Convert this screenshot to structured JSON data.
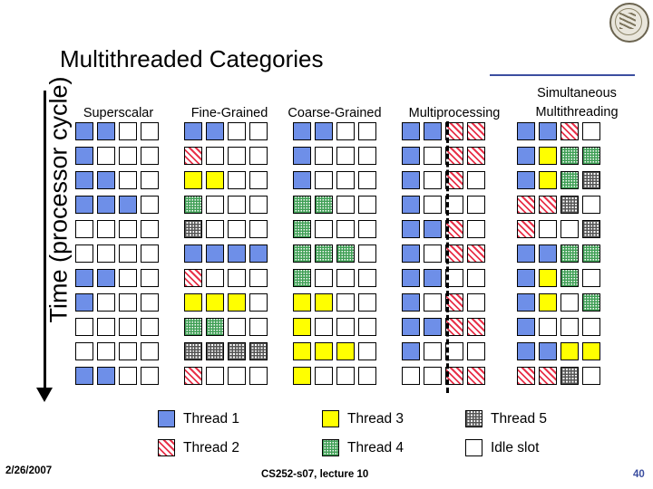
{
  "title": "Multithreaded Categories",
  "y_axis_label": "Time (processor cycle)",
  "columns": [
    {
      "name": "superscalar",
      "label": "Superscalar",
      "label2": ""
    },
    {
      "name": "fine-grained",
      "label": "Fine-Grained",
      "label2": ""
    },
    {
      "name": "coarse-grained",
      "label": "Coarse-Grained",
      "label2": ""
    },
    {
      "name": "multiprocessing",
      "label": "Multiprocessing",
      "label2": ""
    },
    {
      "name": "simultaneous-multithreading",
      "label": "Simultaneous",
      "label2": "Multithreading"
    }
  ],
  "legend": [
    {
      "key": "t1",
      "label": "Thread 1"
    },
    {
      "key": "t3",
      "label": "Thread 3"
    },
    {
      "key": "t5",
      "label": "Thread 5"
    },
    {
      "key": "t2",
      "label": "Thread 2"
    },
    {
      "key": "t4",
      "label": "Thread 4"
    },
    {
      "key": "idle",
      "label": "Idle slot"
    }
  ],
  "footer": {
    "date": "2/26/2007",
    "center": "CS252-s07, lecture 10",
    "page": "40"
  },
  "colors": {
    "thread1": "#6e8fe8",
    "thread2": "#e8324a",
    "thread3": "#ffff00",
    "thread4": "#3f9f55",
    "thread5": "#555555",
    "idle": "#ffffff",
    "accent": "#3b4ea0"
  },
  "grids": {
    "superscalar": [
      [
        "t1",
        "t1",
        "idle",
        "idle"
      ],
      [
        "t1",
        "idle",
        "idle",
        "idle"
      ],
      [
        "t1",
        "t1",
        "idle",
        "idle"
      ],
      [
        "t1",
        "t1",
        "t1",
        "idle"
      ],
      [
        "idle",
        "idle",
        "idle",
        "idle"
      ],
      [
        "idle",
        "idle",
        "idle",
        "idle"
      ],
      [
        "t1",
        "t1",
        "idle",
        "idle"
      ],
      [
        "t1",
        "idle",
        "idle",
        "idle"
      ],
      [
        "idle",
        "idle",
        "idle",
        "idle"
      ],
      [
        "idle",
        "idle",
        "idle",
        "idle"
      ],
      [
        "t1",
        "t1",
        "idle",
        "idle"
      ]
    ],
    "fine-grained": [
      [
        "t1",
        "t1",
        "idle",
        "idle"
      ],
      [
        "t2",
        "idle",
        "idle",
        "idle"
      ],
      [
        "t3",
        "t3",
        "idle",
        "idle"
      ],
      [
        "t4",
        "idle",
        "idle",
        "idle"
      ],
      [
        "t5",
        "idle",
        "idle",
        "idle"
      ],
      [
        "t1",
        "t1",
        "t1",
        "t1"
      ],
      [
        "t2",
        "idle",
        "idle",
        "idle"
      ],
      [
        "t3",
        "t3",
        "t3",
        "idle"
      ],
      [
        "t4",
        "t4",
        "idle",
        "idle"
      ],
      [
        "t5",
        "t5",
        "t5",
        "t5"
      ],
      [
        "t2",
        "idle",
        "idle",
        "idle"
      ]
    ],
    "coarse-grained": [
      [
        "t1",
        "t1",
        "idle",
        "idle"
      ],
      [
        "t1",
        "idle",
        "idle",
        "idle"
      ],
      [
        "t1",
        "idle",
        "idle",
        "idle"
      ],
      [
        "t4",
        "t4",
        "idle",
        "idle"
      ],
      [
        "t4",
        "idle",
        "idle",
        "idle"
      ],
      [
        "t4",
        "t4",
        "t4",
        "idle"
      ],
      [
        "t4",
        "idle",
        "idle",
        "idle"
      ],
      [
        "t3",
        "t3",
        "idle",
        "idle"
      ],
      [
        "t3",
        "idle",
        "idle",
        "idle"
      ],
      [
        "t3",
        "t3",
        "t3",
        "idle"
      ],
      [
        "t3",
        "idle",
        "idle",
        "idle"
      ]
    ],
    "multiprocessing": [
      [
        "t1",
        "t1",
        "t2",
        "t2"
      ],
      [
        "t1",
        "idle",
        "t2",
        "t2"
      ],
      [
        "t1",
        "idle",
        "t2",
        "idle"
      ],
      [
        "t1",
        "idle",
        "idle",
        "idle"
      ],
      [
        "t1",
        "t1",
        "t2",
        "idle"
      ],
      [
        "t1",
        "idle",
        "t2",
        "t2"
      ],
      [
        "t1",
        "t1",
        "idle",
        "idle"
      ],
      [
        "t1",
        "idle",
        "t2",
        "idle"
      ],
      [
        "t1",
        "t1",
        "t2",
        "t2"
      ],
      [
        "t1",
        "idle",
        "idle",
        "idle"
      ],
      [
        "idle",
        "idle",
        "t2",
        "t2"
      ]
    ],
    "simultaneous-multithreading": [
      [
        "t1",
        "t1",
        "t2",
        "idle"
      ],
      [
        "t1",
        "t3",
        "t4",
        "t4"
      ],
      [
        "t1",
        "t3",
        "t4",
        "t5"
      ],
      [
        "t2",
        "t2",
        "t5",
        "idle"
      ],
      [
        "t2",
        "idle",
        "idle",
        "t5"
      ],
      [
        "t1",
        "t1",
        "t4",
        "t4"
      ],
      [
        "t1",
        "t3",
        "t4",
        "idle"
      ],
      [
        "t1",
        "t3",
        "idle",
        "t4"
      ],
      [
        "t1",
        "idle",
        "idle",
        "idle"
      ],
      [
        "t1",
        "t1",
        "t3",
        "t3"
      ],
      [
        "t2",
        "t2",
        "t5",
        "idle"
      ]
    ]
  }
}
